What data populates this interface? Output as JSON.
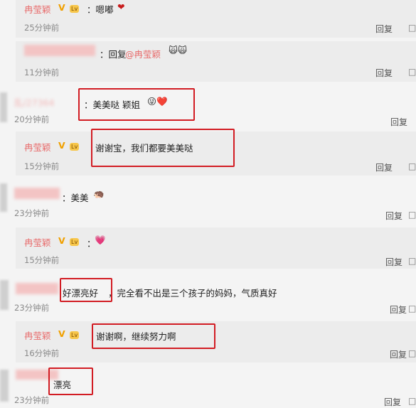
{
  "comments": [
    {
      "user": "冉莹颖",
      "vip": "V",
      "level": "Lv",
      "text": "：嗯嘟",
      "emoji": "❤",
      "time": "25分钟前",
      "reply": "回复"
    },
    {
      "user": "",
      "text": "：回复",
      "mention": "@冉莹颖",
      "emoji": "🙀🙀",
      "time": "11分钟前",
      "reply": "回复"
    },
    {
      "user": "乱/27364",
      "text": "：美美哒 颖姐",
      "emoji": "😜❤️",
      "time": "20分钟前",
      "reply": "回复"
    },
    {
      "user": "冉莹颖",
      "vip": "V",
      "level": "Lv",
      "text": "谢谢宝，我们都要美美哒",
      "time": "15分钟前",
      "reply": "回复"
    },
    {
      "user": "",
      "text": "：美美",
      "emoji": "🦔",
      "time": "23分钟前",
      "reply": "回复"
    },
    {
      "user": "冉莹颖",
      "vip": "V",
      "level": "Lv",
      "text": "：",
      "emoji": "💗",
      "time": "15分钟前",
      "reply": "回复"
    },
    {
      "user": "",
      "text_a": "好漂亮好",
      "text_b": "，完全看不出是三个孩子的妈妈，气质真好",
      "time": "23分钟前",
      "reply": "回复"
    },
    {
      "user": "冉莹颖",
      "vip": "V",
      "level": "Lv",
      "text": "谢谢啊，继续努力啊",
      "time": "16分钟前",
      "reply": "回复"
    },
    {
      "user": "",
      "text": "漂亮",
      "time": "23分钟前",
      "reply": "回复"
    }
  ],
  "side_marks": [
    "□",
    "□",
    "□",
    "□",
    "□",
    "□",
    "□",
    "□"
  ]
}
